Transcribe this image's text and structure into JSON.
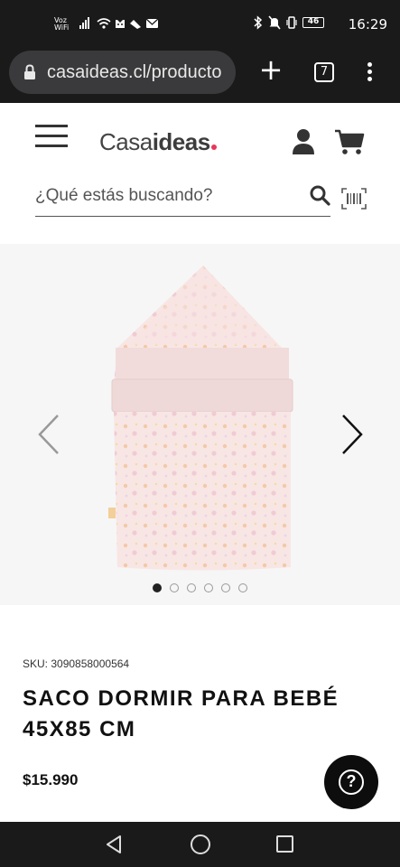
{
  "status_bar": {
    "carrier_top": "Voz",
    "carrier_bottom": "WiFi",
    "battery": "46",
    "time": "16:29"
  },
  "browser": {
    "url": "casaideas.cl/producto",
    "tab_count": "7"
  },
  "header": {
    "logo_light": "Casa",
    "logo_bold": "ideas",
    "search": {
      "placeholder": "¿Qué estás buscando?"
    }
  },
  "gallery": {
    "image_count": 6,
    "active_index": 0
  },
  "product": {
    "sku": "SKU: 3090858000564",
    "title": "SACO DORMIR PARA BEBÉ 45X85 CM",
    "price": "$15.990"
  },
  "help": {
    "label": "?"
  },
  "colors": {
    "system_bar": "#1a1a1a",
    "logo_dot": "#e8365a",
    "product_pink": "#f5dede"
  }
}
